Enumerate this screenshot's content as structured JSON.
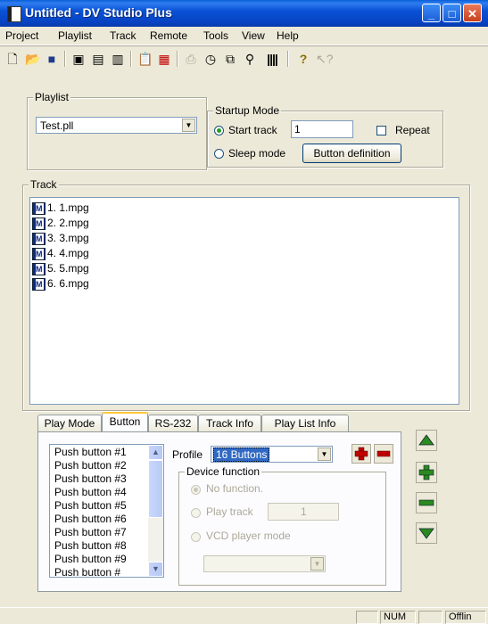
{
  "window": {
    "title": "Untitled - DV Studio Plus"
  },
  "menu": [
    "Project",
    "Playlist",
    "Track",
    "Remote",
    "Tools",
    "View",
    "Help"
  ],
  "toolbar_icons": [
    "new-icon",
    "open-icon",
    "save-icon",
    "track-add-icon",
    "track-import-icon",
    "track-export-icon",
    "paste-icon",
    "pdf-icon",
    "print-icon",
    "timer-icon",
    "remote-icon",
    "search-icon",
    "barcode-icon",
    "help-icon",
    "context-help-icon"
  ],
  "playlist": {
    "legend": "Playlist",
    "selected_file": "Test.pll"
  },
  "startup_mode": {
    "legend": "Startup Mode",
    "start_track_label": "Start track",
    "start_track_value": "1",
    "repeat_label": "Repeat",
    "sleep_mode_label": "Sleep mode",
    "button_definition_label": "Button definition"
  },
  "track": {
    "legend": "Track",
    "items": [
      "1. 1.mpg",
      "2. 2.mpg",
      "3. 3.mpg",
      "4. 4.mpg",
      "5. 5.mpg",
      "6. 6.mpg"
    ]
  },
  "tabs": [
    "Play Mode",
    "Button",
    "RS-232",
    "Track Info",
    "Play List Info"
  ],
  "button_tab": {
    "push_buttons": [
      "Push button #1",
      "Push button #2",
      "Push button #3",
      "Push button #4",
      "Push button #5",
      "Push button #6",
      "Push button #7",
      "Push button #8",
      "Push button #9",
      "Push button #"
    ],
    "profile_label": "Profile",
    "profile_value": "16 Buttons",
    "device_function_legend": "Device function",
    "no_function_label": "No function.",
    "play_track_label": "Play track",
    "play_track_value": "1",
    "vcd_label": "VCD player mode"
  },
  "status": {
    "num": "NUM",
    "offline": "Offlin"
  },
  "colors": {
    "titlebar": "#0a52d6",
    "accent_red": "#c00000",
    "accent_green": "#2a8a1e",
    "selection": "#316ac5"
  }
}
